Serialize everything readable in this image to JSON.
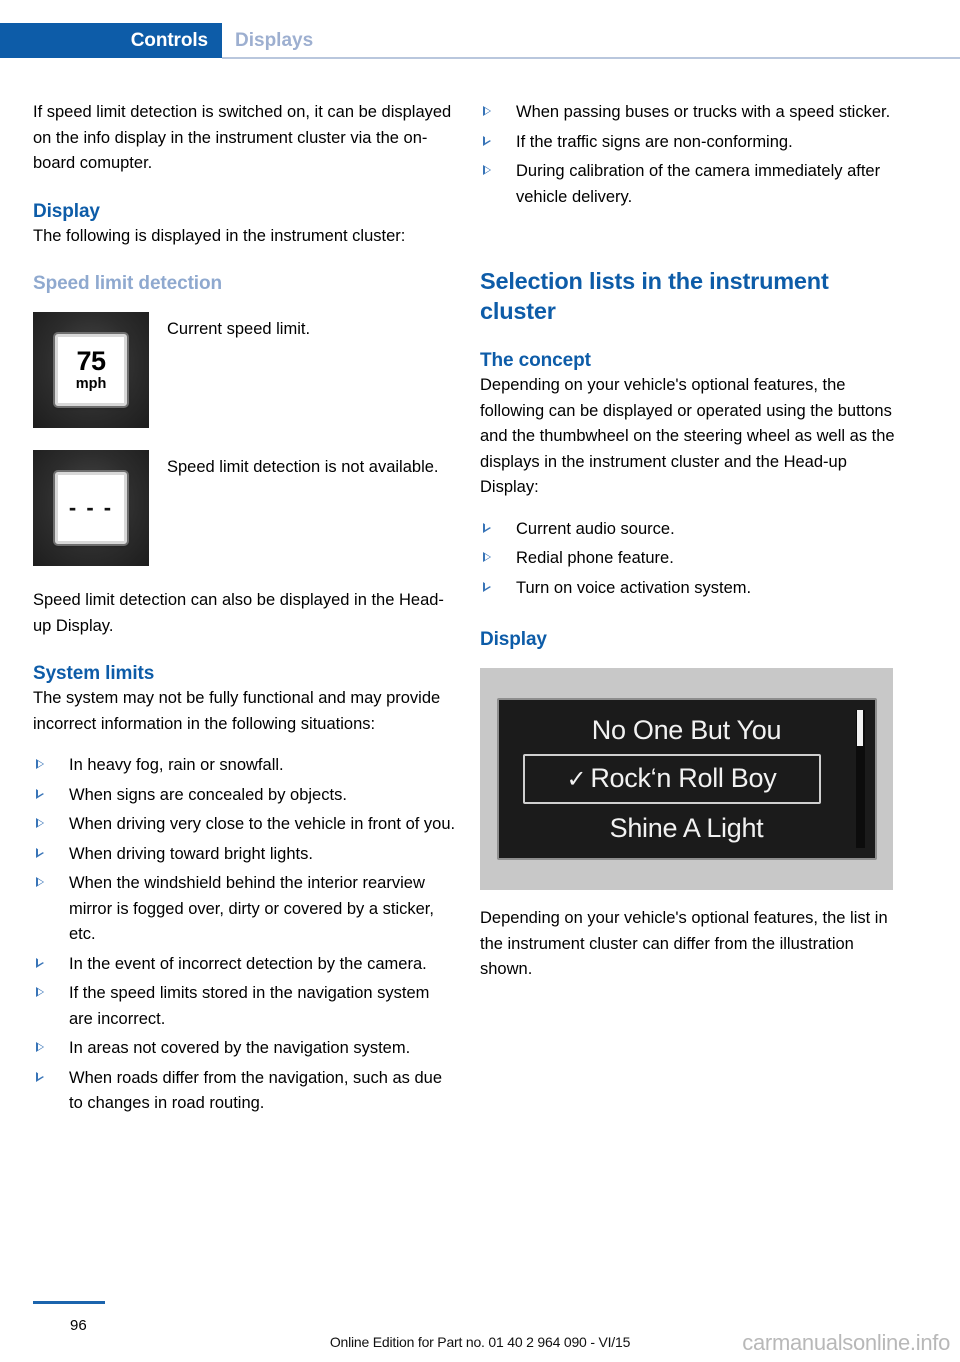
{
  "header": {
    "tab_active": "Controls",
    "tab_inactive": "Displays"
  },
  "colors": {
    "accent_blue": "#0d5ca8",
    "tab_inactive_blue": "#9dafd0",
    "pale_heading_blue": "#8fa9cf",
    "bullet_blue": "#2e6db4"
  },
  "left_column": {
    "intro_paragraph": "If speed limit detection is switched on, it can be displayed on the info display in the instrument cluster via the on-board comupter.",
    "display_heading": "Display",
    "display_paragraph": "The following is displayed in the instrument cluster:",
    "speed_limit_heading": "Speed limit detection",
    "figures": [
      {
        "sign_number": "75",
        "sign_unit": "mph",
        "caption": "Current speed limit."
      },
      {
        "sign_dashes": "- - -",
        "caption": "Speed limit detection is not available."
      }
    ],
    "hud_paragraph": "Speed limit detection can also be displayed in the Head-up Display.",
    "system_limits_heading": "System limits",
    "system_limits_paragraph": "The system may not be fully functional and may provide incorrect information in the following situations:",
    "system_limits_items": [
      "In heavy fog, rain or snowfall.",
      "When signs are concealed by objects.",
      "When driving very close to the vehicle in front of you.",
      "When driving toward bright lights.",
      "When the windshield behind the interior rearview mirror is fogged over, dirty or covered by a sticker, etc.",
      "In the event of incorrect detection by the camera.",
      "If the speed limits stored in the navigation system are incorrect.",
      "In areas not covered by the navigation system.",
      "When roads differ from the navigation, such as due to changes in road routing."
    ]
  },
  "right_column": {
    "continued_items": [
      "When passing buses or trucks with a speed sticker.",
      "If the traffic signs are non-conforming.",
      "During calibration of the camera immediately after vehicle delivery."
    ],
    "section_title": "Selection lists in the instrument cluster",
    "concept_heading": "The concept",
    "concept_paragraph": "Depending on your vehicle's optional features, the following can be displayed or operated using the buttons and the thumbwheel on the steering wheel as well as the displays in the instrument cluster and the Head-up Display:",
    "concept_items": [
      "Current audio source.",
      "Redial phone feature.",
      "Turn on voice activation system."
    ],
    "display_heading": "Display",
    "cluster_illustration": {
      "items": [
        {
          "label": "No One But You",
          "selected": false,
          "checked": false
        },
        {
          "label": "Rock‘n Roll Boy",
          "selected": true,
          "checked": true
        },
        {
          "label": "Shine A Light",
          "selected": false,
          "checked": false
        }
      ],
      "check_glyph": "✓"
    },
    "closing_paragraph": "Depending on your vehicle's optional features, the list in the instrument cluster can differ from the illustration shown."
  },
  "footer": {
    "page_number": "96",
    "edition_text": "Online Edition for Part no. 01 40 2 964 090 - VI/15",
    "watermark": "carmanualsonline.info"
  }
}
